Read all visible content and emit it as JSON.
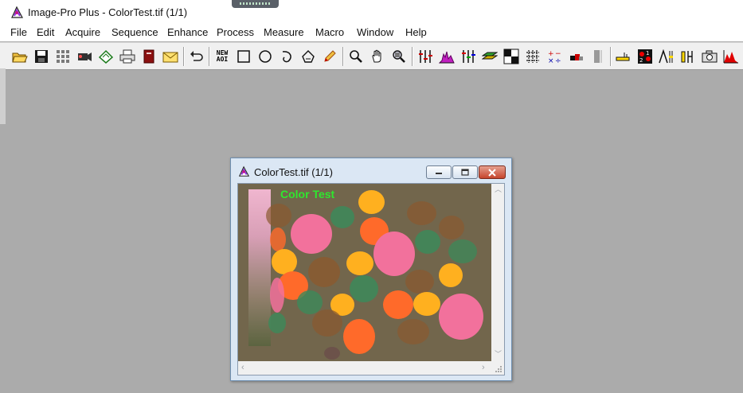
{
  "app": {
    "title": "Image-Pro Plus - ColorTest.tif (1/1)"
  },
  "menu": [
    "File",
    "Edit",
    "Acquire",
    "Sequence",
    "Enhance",
    "Process",
    "Measure",
    "Macro",
    "Window",
    "Help"
  ],
  "toolbar": {
    "new_aoi_line1": "NEW",
    "new_aoi_line2": "AOI"
  },
  "image_window": {
    "title": "ColorTest.tif (1/1)",
    "canvas_label": "Color Test"
  },
  "colors": {
    "canvas_background": "#72664c",
    "pink": "#f2719c",
    "orange": "#ff6a2a",
    "yellow": "#ffb01f",
    "green": "#3c8a5a",
    "brown": "#8a5a30",
    "label_green": "#2ee82e"
  }
}
